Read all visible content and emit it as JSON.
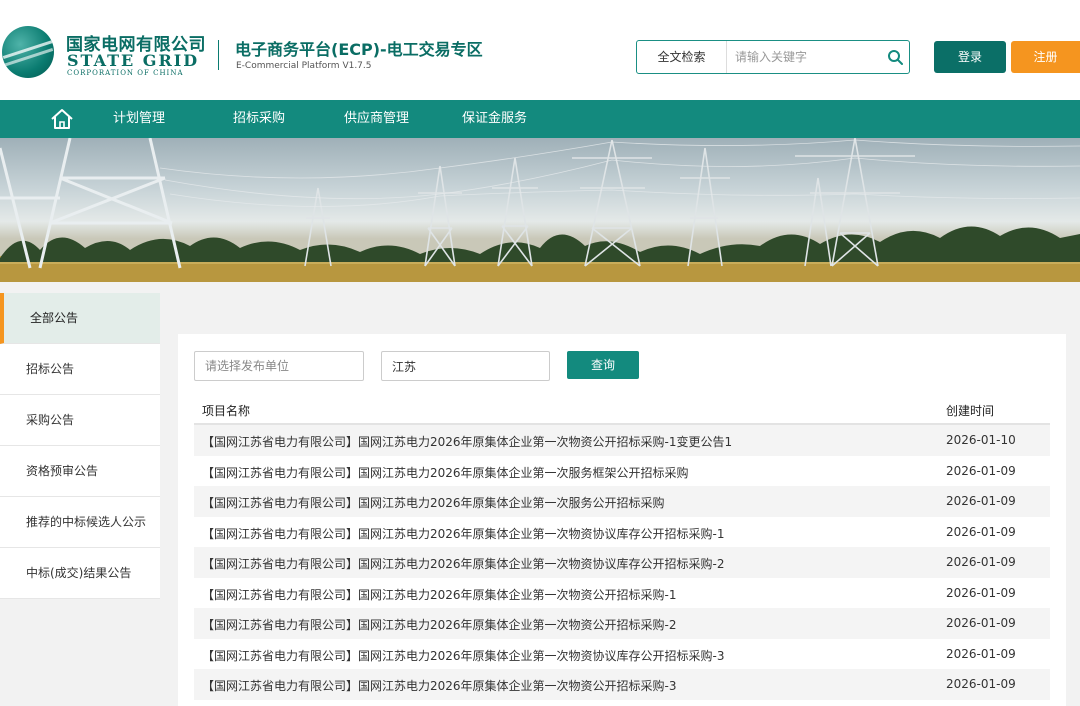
{
  "header": {
    "logo_cn": "国家电网有限公司",
    "logo_en": "STATE GRID",
    "logo_en_small": "CORPORATION OF CHINA",
    "platform_title": "电子商务平台(ECP)-电工交易专区",
    "platform_subtitle": "E-Commercial Platform V1.7.5",
    "search_type": "全文检索",
    "search_placeholder": "请输入关键字",
    "login_label": "登录",
    "register_label": "注册"
  },
  "nav": {
    "items": [
      "计划管理",
      "招标采购",
      "供应商管理",
      "保证金服务"
    ]
  },
  "sidebar": {
    "items": [
      {
        "label": "全部公告"
      },
      {
        "label": "招标公告"
      },
      {
        "label": "采购公告"
      },
      {
        "label": "资格预审公告"
      },
      {
        "label": "推荐的中标候选人公示"
      },
      {
        "label": "中标(成交)结果公告"
      }
    ]
  },
  "filters": {
    "unit_placeholder": "请选择发布单位",
    "region_value": "江苏",
    "query_label": "查询"
  },
  "table": {
    "col_name": "项目名称",
    "col_date": "创建时间",
    "rows": [
      {
        "name": "【国网江苏省电力有限公司】国网江苏电力2026年原集体企业第一次物资公开招标采购-1变更公告1",
        "date": "2026-01-10"
      },
      {
        "name": "【国网江苏省电力有限公司】国网江苏电力2026年原集体企业第一次服务框架公开招标采购",
        "date": "2026-01-09"
      },
      {
        "name": "【国网江苏省电力有限公司】国网江苏电力2026年原集体企业第一次服务公开招标采购",
        "date": "2026-01-09"
      },
      {
        "name": "【国网江苏省电力有限公司】国网江苏电力2026年原集体企业第一次物资协议库存公开招标采购-1",
        "date": "2026-01-09"
      },
      {
        "name": "【国网江苏省电力有限公司】国网江苏电力2026年原集体企业第一次物资协议库存公开招标采购-2",
        "date": "2026-01-09"
      },
      {
        "name": "【国网江苏省电力有限公司】国网江苏电力2026年原集体企业第一次物资公开招标采购-1",
        "date": "2026-01-09"
      },
      {
        "name": "【国网江苏省电力有限公司】国网江苏电力2026年原集体企业第一次物资公开招标采购-2",
        "date": "2026-01-09"
      },
      {
        "name": "【国网江苏省电力有限公司】国网江苏电力2026年原集体企业第一次物资协议库存公开招标采购-3",
        "date": "2026-01-09"
      },
      {
        "name": "【国网江苏省电力有限公司】国网江苏电力2026年原集体企业第一次物资公开招标采购-3",
        "date": "2026-01-09"
      }
    ]
  },
  "colors": {
    "brand_green": "#138a7e",
    "dark_green": "#0b6f67",
    "accent_orange": "#f5951f"
  }
}
